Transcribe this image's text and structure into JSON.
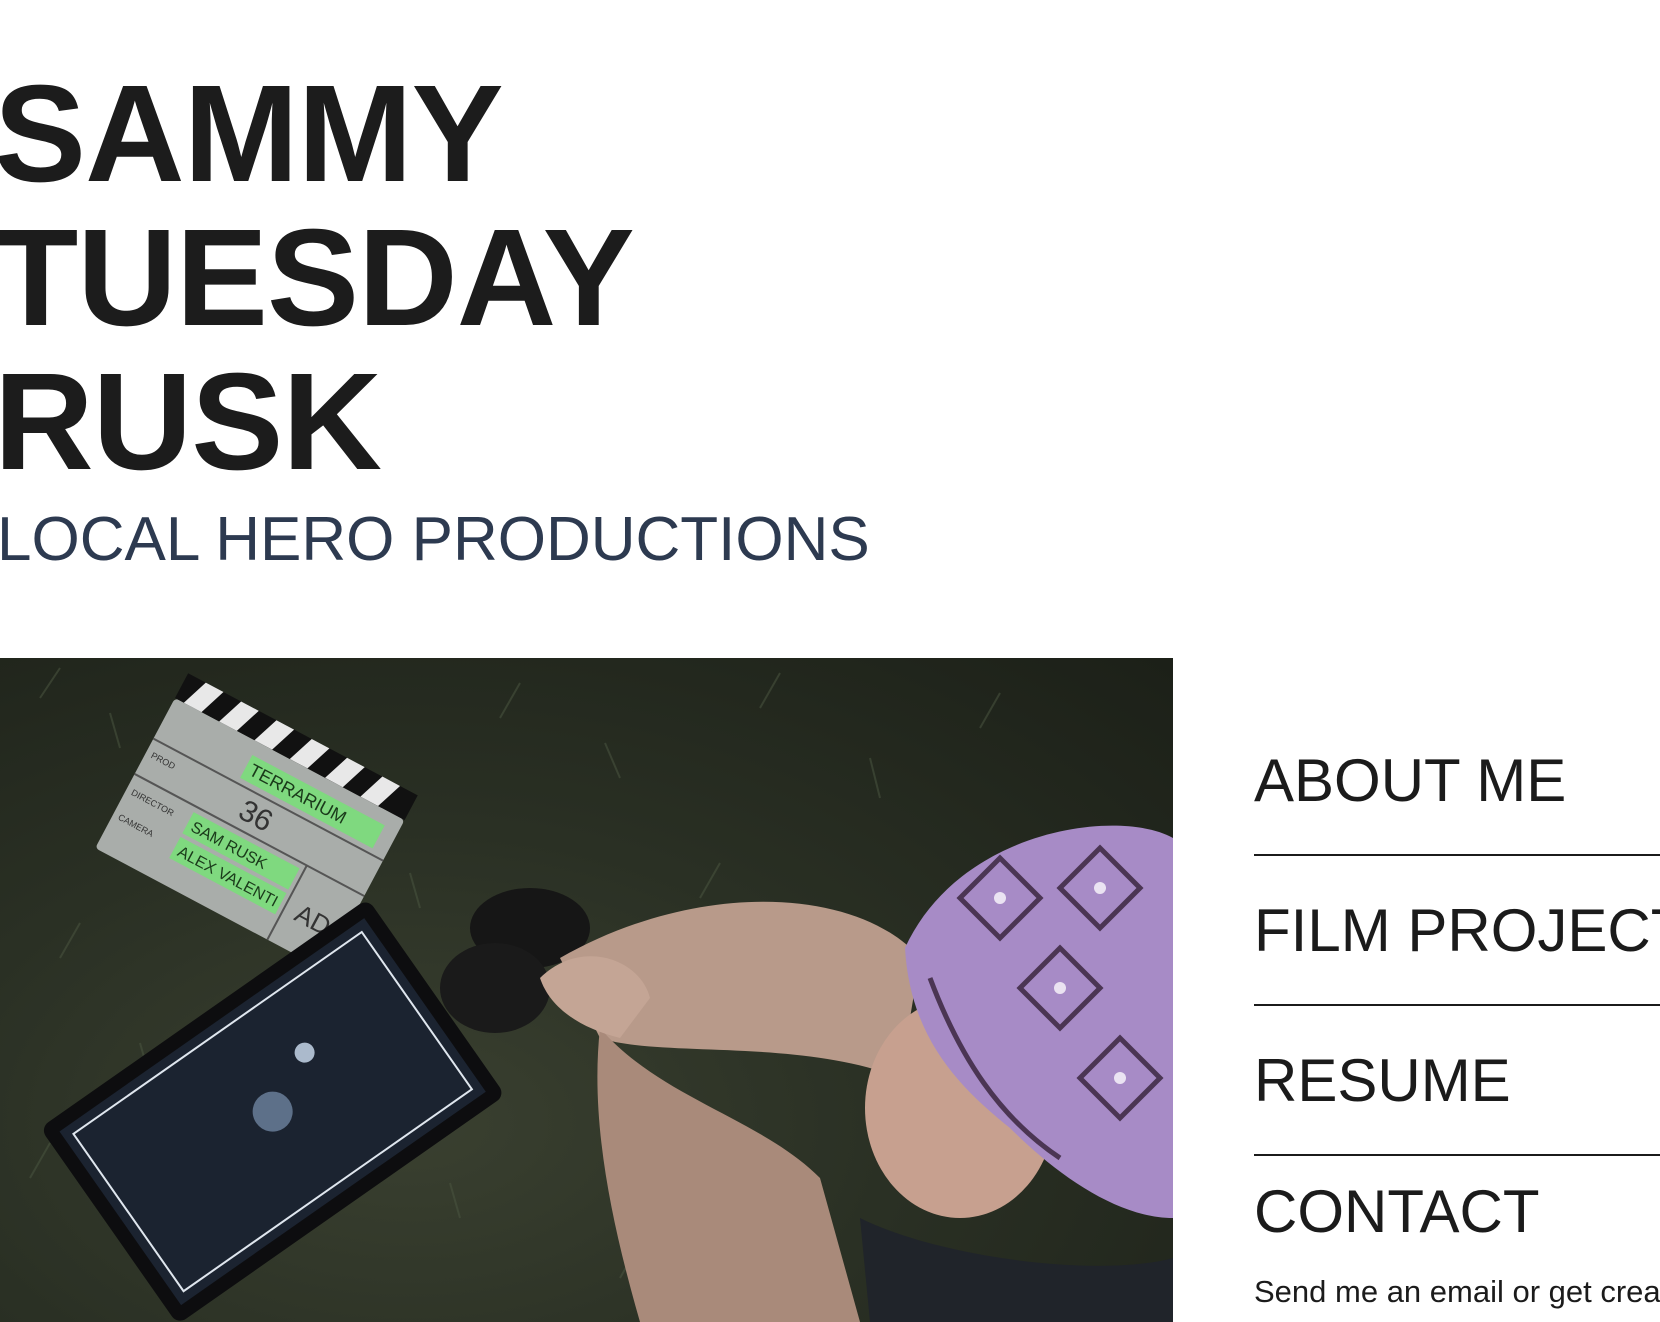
{
  "header": {
    "title_lines": [
      "SAMMY",
      "TUESDAY",
      "RUSK"
    ],
    "subtitle": "LOCAL HERO PRODUCTIONS"
  },
  "hero_image": {
    "alt": "Person in a purple knit beanie sitting on grass at night beside a film slate and a monitor",
    "slate": {
      "title": "TERRARIUM",
      "scene": "36",
      "director": "SAM RUSK",
      "camera": "ALEX VALENTI",
      "take": "AD",
      "labels": [
        "PROD",
        "DIRECTOR",
        "CAMERA"
      ]
    }
  },
  "nav": {
    "items": [
      "ABOUT ME",
      "FILM PROJECTS",
      "RESUME",
      "CONTACT"
    ]
  },
  "contact": {
    "note": "Send me an email or get creative"
  },
  "colors": {
    "text": "#1b1b1b",
    "subtitle": "#2d3a50",
    "beanie": "#a78bc6"
  }
}
